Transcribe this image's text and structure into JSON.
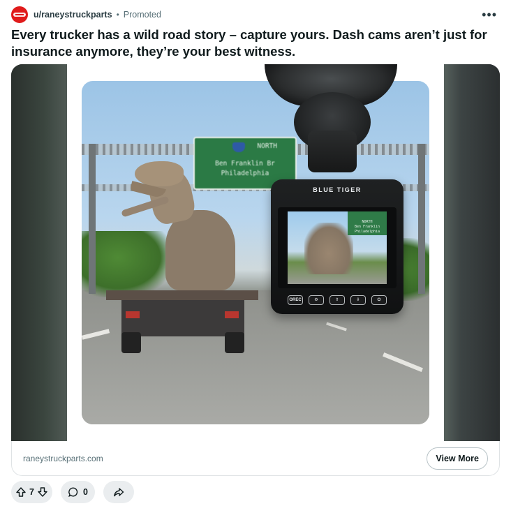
{
  "post": {
    "author": "u/raneystruckparts",
    "separator": "•",
    "promoted_label": "Promoted",
    "more_label": "•••",
    "title": "Every trucker has a wild road story – capture yours. Dash cams aren’t just for insurance anymore, they’re your best witness."
  },
  "media": {
    "sign_lines": [
      "NORTH",
      "Ben Franklin Br",
      "Philadelphia"
    ],
    "camera_brand": "BLUE TIGER",
    "screen_sign_lines": [
      "NORTH",
      "Ben Franklin",
      "Philadelphia"
    ],
    "camera_buttons": [
      "OREC",
      "⚙",
      "⇧",
      "⇩",
      "⏻"
    ]
  },
  "link": {
    "domain": "raneystruckparts.com",
    "cta_label": "View More"
  },
  "actions": {
    "vote_count": "7",
    "comment_count": "0"
  },
  "colors": {
    "avatar": "#e01b1b",
    "pill_bg": "#eaedef",
    "text_primary": "#0f1a1c",
    "text_secondary": "#576f76"
  },
  "icons": {
    "upvote": "arrow-up-icon",
    "downvote": "arrow-down-icon",
    "comment": "comment-bubble-icon",
    "share": "share-arrow-icon",
    "more": "more-horizontal-icon"
  }
}
